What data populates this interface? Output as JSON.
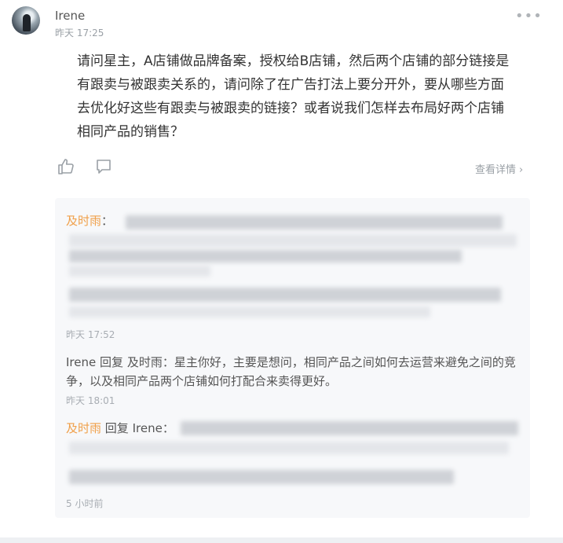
{
  "post": {
    "author": "Irene",
    "timestamp": "昨天 17:25",
    "more_icon": "more-horizontal-icon",
    "question": "请问星主，A店铺做品牌备案，授权给B店铺，然后两个店铺的部分链接是有跟卖与被跟卖关系的，请问除了在广告打法上要分开外，要从哪些方面去优化好这些有跟卖与被跟卖的链接？或者说我们怎样去布局好两个店铺相同产品的销售？",
    "detail_link": "查看详情"
  },
  "comments": [
    {
      "name": "及时雨",
      "sep": "：",
      "timestamp": "昨天 17:52"
    },
    {
      "name": "Irene",
      "reply_word": "回复",
      "reply_to": "及时雨",
      "sep": "：",
      "text": "星主你好，主要是想问，相同产品之间如何去运营来避免之间的竞争，以及相同产品两个店铺如何打配合来卖得更好。",
      "timestamp": "昨天 18:01"
    },
    {
      "name": "及时雨",
      "reply_word": "回复",
      "reply_to": "Irene",
      "sep": "：",
      "timestamp": "5 小时前"
    }
  ]
}
